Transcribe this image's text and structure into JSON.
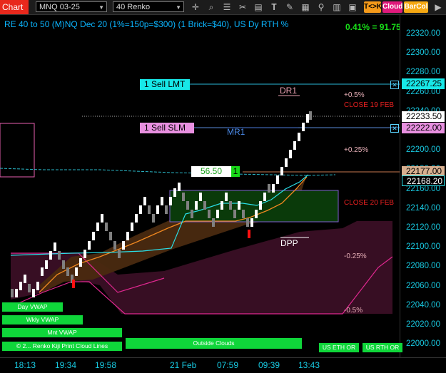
{
  "toolbar": {
    "chart_tab": "Chart",
    "instrument": "MNQ 03-25",
    "bar_type": "40 Renko",
    "btn_tk": "T<>K",
    "btn_cloud": "Cloud",
    "btn_barcol": "BarCol"
  },
  "chart": {
    "title": "RE 40 to 50 (M)NQ Dec 20 (1%=150p=$300) (1 Brick=$40), US Dy RTH %",
    "pct_readout": "0.41% = 91.75"
  },
  "price_axis": [
    "22320.00",
    "22300.00",
    "22280.00",
    "22260.00",
    "22240.00",
    "22220.00",
    "22200.00",
    "22180.00",
    "22160.00",
    "22140.00",
    "22120.00",
    "22100.00",
    "22080.00",
    "22060.00",
    "22040.00",
    "22020.00",
    "22000.00"
  ],
  "price_tags": {
    "sell_lmt_price": "22267.25",
    "current_price": "22233.50",
    "sell_slm_price": "22222.00",
    "vwap_price": "22177.00",
    "cyan_price": "22168.20"
  },
  "time_axis": [
    "18:13",
    "19:34",
    "19:58",
    "21 Feb",
    "07:59",
    "09:39",
    "13:43"
  ],
  "orders": {
    "sell_lmt": "1 Sell LMT",
    "sell_slm": "1 Sell SLM",
    "pnl_value": "56.50",
    "pnl_qty": "1"
  },
  "annotations": {
    "dr1": "DR1",
    "mr1": "MR1",
    "dpp": "DPP",
    "plus_05": "+0.5%",
    "close_19": "CLOSE 19 FEB",
    "plus_025": "+0.25%",
    "close_20": "CLOSE 20 FEB",
    "minus_025": "-0.25%",
    "minus_05": "-0.5%"
  },
  "buttons": {
    "day_vwap": "Day VWAP",
    "wkly_vwap": "Wkly VWAP",
    "mnt_vwap": "Mnt VWAP",
    "print_lines": "© 2... Renko Kiji Print Cloud Lines",
    "outside_clouds": "Outside Clouds",
    "us_eth_or": "US ETH OR",
    "us_rth_or": "US RTH OR"
  },
  "colors": {
    "accent_cyan": "#18c8e0",
    "brick_up": "#ffffff",
    "brick_down": "#808080",
    "green_button": "#0fd63a"
  }
}
